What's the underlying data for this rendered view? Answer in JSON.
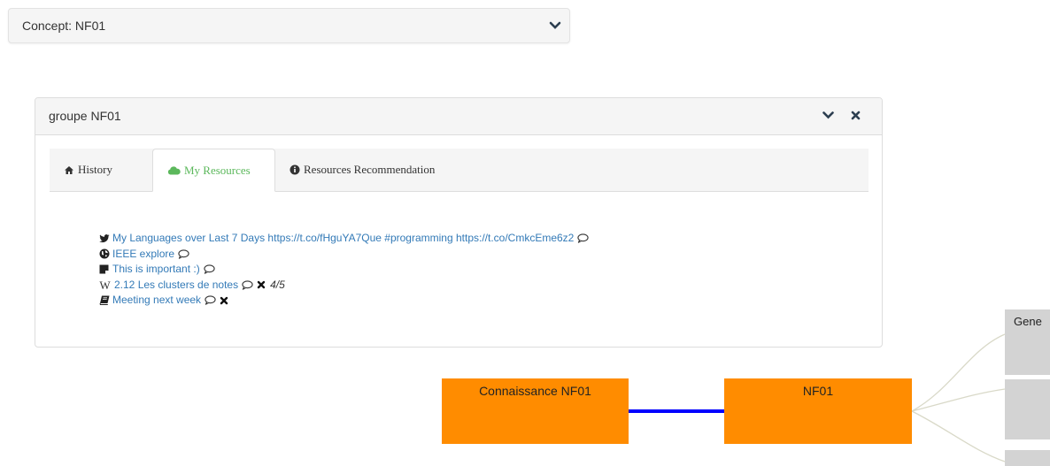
{
  "concept": {
    "title": "Concept: NF01"
  },
  "group_panel": {
    "title": "groupe NF01",
    "tabs": [
      {
        "label": "History",
        "icon": "home-icon"
      },
      {
        "label": "My Resources",
        "icon": "cloud-icon"
      },
      {
        "label": "Resources Recommendation",
        "icon": "info-circle-icon"
      }
    ],
    "active_tab": "My Resources",
    "resources": [
      {
        "icon": "twitter-icon",
        "label": "My Languages over Last 7 Days https://t.co/fHguYA7Que #programming https://t.co/CmkcEme6z2"
      },
      {
        "icon": "globe-icon",
        "label": "IEEE explore"
      },
      {
        "icon": "sticky-note-icon",
        "label": "This is important :)"
      },
      {
        "icon": "wikipedia-icon",
        "icon_glyph": "W",
        "label": "2.12 Les clusters de notes",
        "rating": "4/5"
      },
      {
        "icon": "book-icon",
        "label": "Meeting next week"
      }
    ]
  },
  "graph": {
    "nodes": [
      {
        "label": "Connaissance NF01"
      },
      {
        "label": "NF01"
      }
    ],
    "side_boxes": [
      {
        "label": "Gene"
      },
      {
        "label": ""
      },
      {
        "label": ""
      }
    ],
    "colors": {
      "node": "#ff8c00",
      "edge": "#0000ff",
      "side_box": "#d3d3d3",
      "branch": "#d9d9c8"
    }
  },
  "colors": {
    "link": "#337ab7",
    "active_tab": "#5cb85c"
  }
}
